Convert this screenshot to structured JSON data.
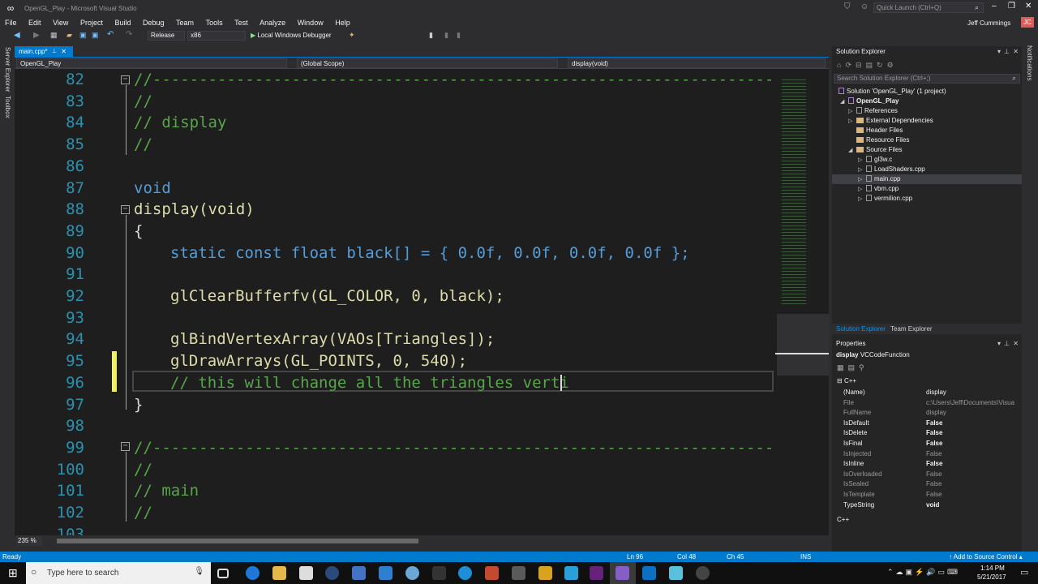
{
  "window": {
    "title": "OpenGL_Play - Microsoft Visual Studio",
    "quick_launch": "Quick Launch (Ctrl+Q)",
    "user": "Jeff Cummings",
    "user_initials": "JC"
  },
  "menu": [
    "File",
    "Edit",
    "View",
    "Project",
    "Build",
    "Debug",
    "Team",
    "Tools",
    "Test",
    "Analyze",
    "Window",
    "Help"
  ],
  "toolbar": {
    "config": "Release",
    "platform": "x86",
    "run": "Local Windows Debugger"
  },
  "side_tabs": {
    "left": [
      "Server Explorer",
      "Toolbox"
    ],
    "right": [
      "Notifications"
    ]
  },
  "editor": {
    "tab": "main.cpp*",
    "nav_project": "OpenGL_Play",
    "nav_scope": "(Global Scope)",
    "nav_member": "display(void)",
    "zoom": "235 %",
    "lines": [
      {
        "n": "82",
        "t": "//--------------------------------------------------------------------------"
      },
      {
        "n": "83",
        "t": "//"
      },
      {
        "n": "84",
        "t": "// display"
      },
      {
        "n": "85",
        "t": "//"
      },
      {
        "n": "86",
        "t": ""
      },
      {
        "n": "87",
        "t": "void"
      },
      {
        "n": "88",
        "t": "display(void)"
      },
      {
        "n": "89",
        "t": "{"
      },
      {
        "n": "90",
        "t": "static const float black[] = { 0.0f, 0.0f, 0.0f, 0.0f };"
      },
      {
        "n": "91",
        "t": ""
      },
      {
        "n": "92",
        "t": "glClearBufferfv(GL_COLOR, 0, black);"
      },
      {
        "n": "93",
        "t": ""
      },
      {
        "n": "94",
        "t": "glBindVertexArray(VAOs[Triangles]);"
      },
      {
        "n": "95",
        "t": "glDrawArrays(GL_POINTS, 0, 540);"
      },
      {
        "n": "96",
        "t": "// this will change all the triangles verti"
      },
      {
        "n": "97",
        "t": "}"
      },
      {
        "n": "98",
        "t": ""
      },
      {
        "n": "99",
        "t": "//--------------------------------------------------------------------------"
      },
      {
        "n": "100",
        "t": "//"
      },
      {
        "n": "101",
        "t": "// main"
      },
      {
        "n": "102",
        "t": "//"
      },
      {
        "n": "103",
        "t": ""
      }
    ]
  },
  "solution_explorer": {
    "title": "Solution Explorer",
    "search_placeholder": "Search Solution Explorer (Ctrl+;)",
    "items": [
      "Solution 'OpenGL_Play' (1 project)",
      "OpenGL_Play",
      "References",
      "External Dependencies",
      "Header Files",
      "Resource Files",
      "Source Files",
      "gl3w.c",
      "LoadShaders.cpp",
      "main.cpp",
      "vbm.cpp",
      "vermilion.cpp"
    ],
    "bottom_tabs": [
      "Solution Explorer",
      "Team Explorer"
    ]
  },
  "properties": {
    "title": "Properties",
    "object": "display",
    "object_type": "VCCodeFunction",
    "category": "C++",
    "rows": [
      {
        "name": "(Name)",
        "value": "display"
      },
      {
        "name": "File",
        "value": "c:\\Users\\Jeff\\Documents\\Visua"
      },
      {
        "name": "FullName",
        "value": "display"
      },
      {
        "name": "IsDefault",
        "value": "False"
      },
      {
        "name": "IsDelete",
        "value": "False"
      },
      {
        "name": "IsFinal",
        "value": "False"
      },
      {
        "name": "IsInjected",
        "value": "False"
      },
      {
        "name": "IsInline",
        "value": "False"
      },
      {
        "name": "IsOverloaded",
        "value": "False"
      },
      {
        "name": "IsSealed",
        "value": "False"
      },
      {
        "name": "IsTemplate",
        "value": "False"
      },
      {
        "name": "TypeString",
        "value": "void"
      }
    ],
    "footer": "C++"
  },
  "status": {
    "ready": "Ready",
    "ln": "Ln 96",
    "col": "Col 48",
    "ch": "Ch 45",
    "ins": "INS",
    "source_control": "Add to Source Control"
  },
  "taskbar": {
    "search": "Type here to search",
    "time": "1:14 PM",
    "date": "5/21/2017"
  },
  "colors": {
    "accent": "#007acc",
    "keyword": "#569cd6",
    "comment": "#57a64a",
    "function": "#dcdcaa",
    "number": "#b5cea8",
    "macro": "#bd63c5",
    "type": "#4ec9b0",
    "linenum": "#2b91af"
  }
}
